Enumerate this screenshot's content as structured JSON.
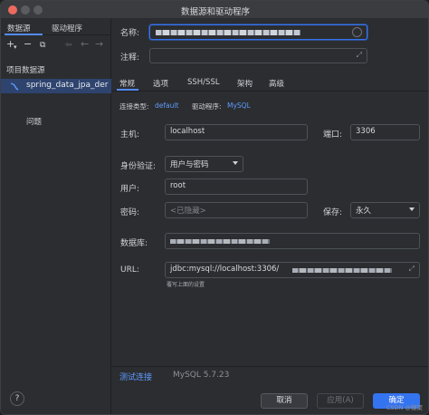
{
  "window": {
    "title": "数据源和驱动程序"
  },
  "left": {
    "tabs": [
      "数据源",
      "驱动程序"
    ],
    "toolbar": [
      "+",
      "−",
      "⧉",
      "⇦",
      "←",
      "→"
    ],
    "section_label": "项目数据源",
    "datasource": "spring_data_jpa_der",
    "problems_label": "问题",
    "help": "?"
  },
  "form": {
    "name_label": "名称:",
    "comment_label": "注释:",
    "tabs": [
      "常规",
      "选项",
      "SSH/SSL",
      "架构",
      "高级"
    ],
    "conn_type_label": "连接类型:",
    "conn_type_value": "default",
    "driver_label": "驱动程序:",
    "driver_value": "MySQL",
    "host_label": "主机:",
    "host_value": "localhost",
    "port_label": "端口:",
    "port_value": "3306",
    "auth_label": "身份验证:",
    "auth_value": "用户与密码",
    "user_label": "用户:",
    "user_value": "root",
    "password_label": "密码:",
    "password_placeholder": "<已隐藏>",
    "save_label": "保存:",
    "save_value": "永久",
    "db_label": "数据库:",
    "url_label": "URL:",
    "url_value": "jdbc:mysql://localhost:3306/",
    "url_hint": "覆写上面的设置",
    "test_link": "测试连接",
    "server_version": "MySQL 5.7.23"
  },
  "buttons": {
    "cancel": "取消",
    "apply": "应用(A)",
    "ok": "确定"
  },
  "watermark": "CSDN @猿聚",
  "colors": {
    "accent": "#3574f0",
    "link": "#5f9bff",
    "selection": "#2e436e"
  }
}
